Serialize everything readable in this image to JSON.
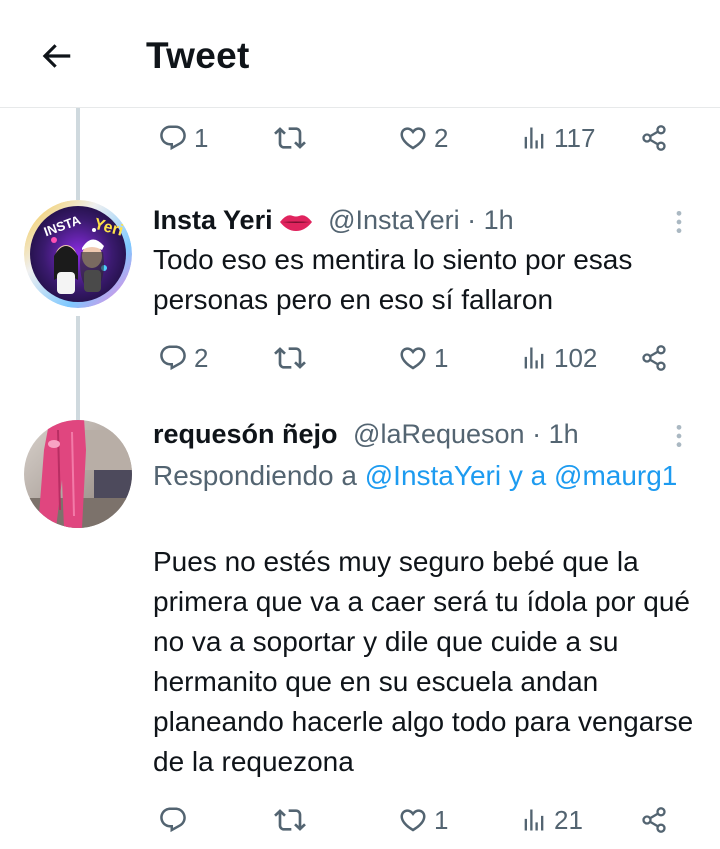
{
  "header": {
    "title": "Tweet",
    "back_icon": "arrow-left-icon"
  },
  "colors": {
    "text_primary": "#0f1419",
    "text_secondary": "#536471",
    "link": "#1d9bf0",
    "thread_line": "#cfd9de",
    "lips": "#e0245e"
  },
  "top_actions": {
    "replies": "1",
    "likes": "2",
    "views": "117"
  },
  "tweets": [
    {
      "name": "Insta Yeri",
      "emoji_icon": "lips-icon",
      "handle": "@InstaYeri",
      "separator": "·",
      "time": "1h",
      "text": "Todo eso es mentira lo siento por esas personas pero en eso sí fallaron",
      "actions": {
        "replies": "2",
        "likes": "1",
        "views": "102"
      }
    },
    {
      "name": "requesón ñejo",
      "handle": "@laRequeson",
      "separator": "·",
      "time": "1h",
      "reply_prefix": "Respondiendo a ",
      "reply_user_1": "@InstaYeri",
      "reply_and": " y a ",
      "reply_user_2": "@maurg1",
      "text": "Pues no estés muy seguro bebé que la primera que va a caer será tu ídola por qué no va a soportar y dile que cuide a su hermanito que en su escuela andan planeando hacerle algo todo para vengarse de la requezona",
      "actions": {
        "likes": "1",
        "views": "21"
      }
    }
  ]
}
